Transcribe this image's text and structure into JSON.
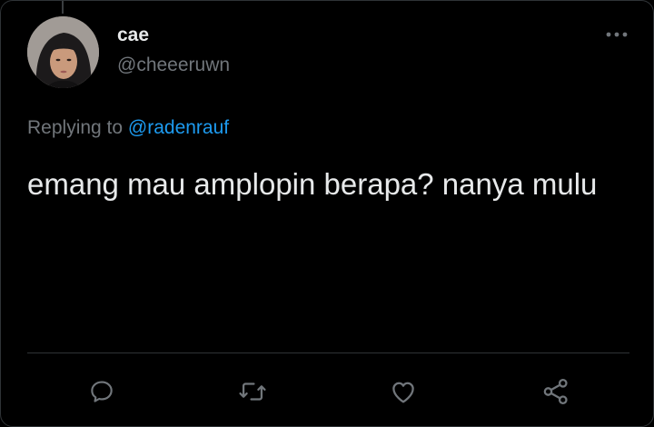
{
  "tweet": {
    "author": {
      "display_name": "cae",
      "handle": "@cheeeruwn"
    },
    "replying_prefix": "Replying to ",
    "replying_to": "@radenrauf",
    "text": "emang mau amplopin berapa? nanya mulu"
  },
  "actions": {
    "reply_icon": "reply-icon",
    "retweet_icon": "retweet-icon",
    "like_icon": "heart-icon",
    "share_icon": "share-icon",
    "more_icon": "more-horizontal-icon"
  },
  "colors": {
    "background": "#000000",
    "text_primary": "#e7e9ea",
    "text_secondary": "#71767b",
    "link": "#1d9bf0",
    "divider": "#2f3336"
  }
}
